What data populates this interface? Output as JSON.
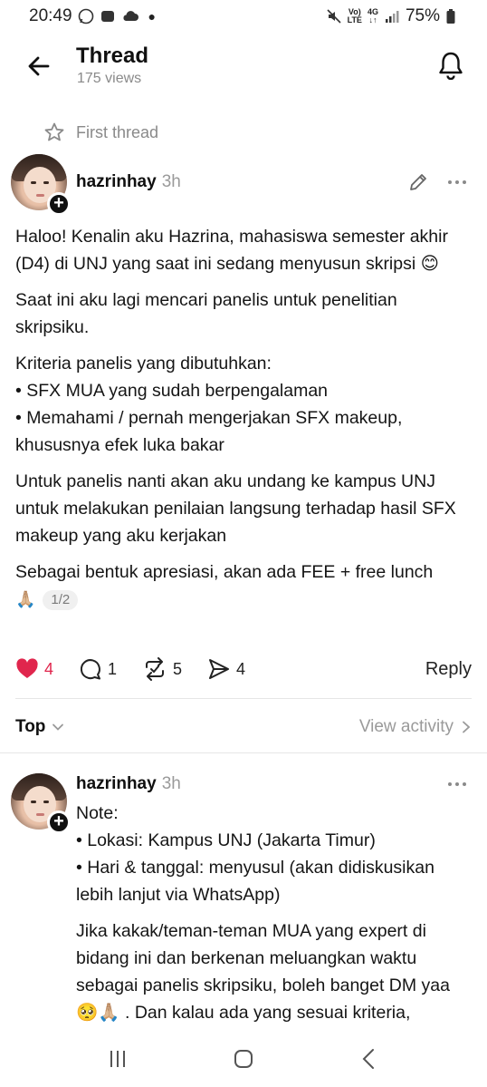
{
  "status_bar": {
    "time": "20:49",
    "battery": "75%",
    "network_top": "Vo)",
    "network_bottom": "LTE",
    "signal_label_top": "4G",
    "signal_label_bottom": "↓↑"
  },
  "header": {
    "title": "Thread",
    "views": "175 views"
  },
  "first_thread_label": "First thread",
  "post": {
    "username": "hazrinhay",
    "time_ago": "3h",
    "paragraphs": [
      "Haloo! Kenalin aku Hazrina, mahasiswa semester akhir (D4) di UNJ yang saat ini sedang menyusun skripsi 😊",
      "Saat ini aku lagi mencari panelis untuk penelitian skripsiku.",
      "Kriteria panelis yang dibutuhkan:",
      "• SFX MUA yang sudah berpengalaman",
      "• Memahami / pernah mengerjakan SFX makeup, khususnya efek luka bakar",
      "Untuk panelis nanti akan aku undang ke kampus UNJ untuk melakukan penilaian langsung terhadap hasil SFX makeup yang aku kerjakan",
      "Sebagai bentuk apresiasi, akan ada FEE + free lunch"
    ],
    "trailing_emoji": "🙏🏼",
    "pager": "1/2",
    "likes": "4",
    "comments": "1",
    "reposts": "5",
    "shares": "4",
    "reply_label": "Reply"
  },
  "sort": {
    "label": "Top",
    "view_activity": "View activity"
  },
  "reply": {
    "username": "hazrinhay",
    "time_ago": "3h",
    "lines": [
      "Note:",
      "• Lokasi: Kampus UNJ (Jakarta Timur)",
      "• Hari & tanggal: menyusul (akan didiskusikan lebih lanjut via WhatsApp)"
    ],
    "paragraph2": "Jika kakak/teman-teman MUA yang expert di bidang ini dan berkenan meluangkan waktu sebagai panelis skripsiku, boleh banget DM yaa 🥺🙏🏼 . Dan kalau ada yang sesuai kriteria,"
  },
  "colors": {
    "like_red": "#e0264d",
    "muted_gray": "#8a8a8a",
    "text": "#101010"
  },
  "icons": [
    "arrow-left-icon",
    "bell-icon",
    "star-icon",
    "pencil-icon",
    "more-icon",
    "heart-icon",
    "comment-icon",
    "repost-icon",
    "send-icon",
    "chevron-down-icon",
    "chevron-right-icon"
  ]
}
